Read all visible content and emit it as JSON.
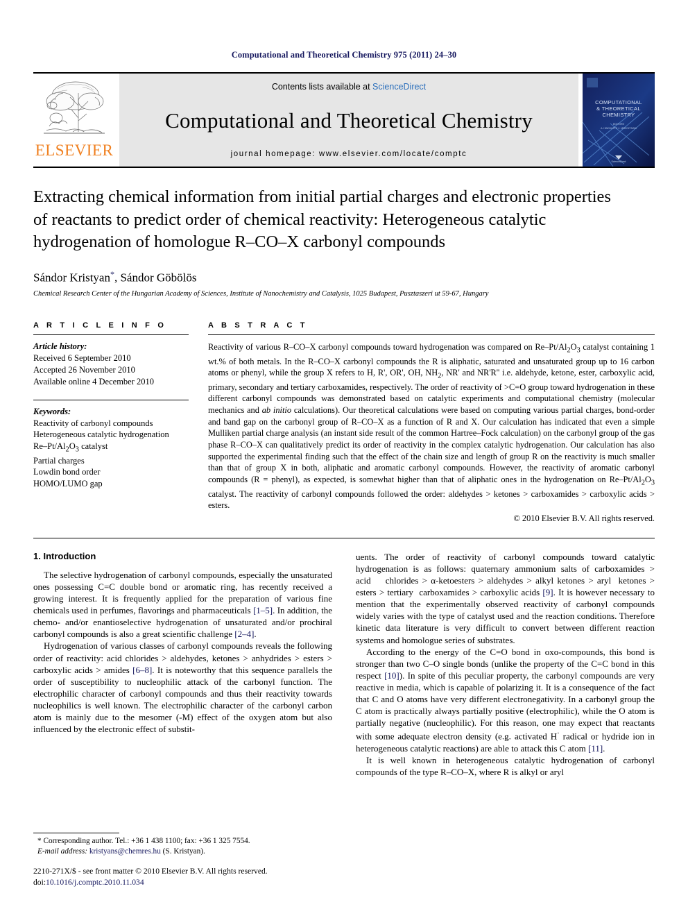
{
  "running_head": "Computational and Theoretical Chemistry 975 (2011) 24–30",
  "masthead": {
    "publisher_name": "ELSEVIER",
    "contents_prefix": "Contents lists available at ",
    "sciencedirect": "ScienceDirect",
    "journal_name": "Computational and Theoretical Chemistry",
    "homepage": "journal homepage: www.elsevier.com/locate/comptc",
    "cover_title_line1": "COMPUTATIONAL",
    "cover_title_line2": "& THEORETICAL",
    "cover_title_line3": "CHEMISTRY",
    "cover_sciencedirect": "ScienceDirect"
  },
  "article": {
    "title": "Extracting chemical information from initial partial charges and electronic properties of reactants to predict order of chemical reactivity: Heterogeneous catalytic hydrogenation of homologue R–CO–X carbonyl compounds",
    "authors": "Sándor Kristyan",
    "author_star": "*",
    "authors_rest": ", Sándor Göbölös",
    "affiliation": "Chemical Research Center of the Hungarian Academy of Sciences, Institute of Nanochemistry and Catalysis, 1025 Budapest, Pusztaszeri ut 59-67, Hungary"
  },
  "article_info": {
    "heading": "A R T I C L E   I N F O",
    "history_label": "Article history:",
    "history": [
      "Received 6 September 2010",
      "Accepted 26 November 2010",
      "Available online 4 December 2010"
    ],
    "keywords_label": "Keywords:",
    "keywords": [
      "Reactivity of carbonyl compounds",
      "Heterogeneous catalytic hydrogenation",
      "Re–Pt/Al2O3 catalyst",
      "Partial charges",
      "Lowdin bond order",
      "HOMO/LUMO gap"
    ]
  },
  "abstract": {
    "heading": "A B S T R A C T",
    "text": "Reactivity of various R–CO–X carbonyl compounds toward hydrogenation was compared on Re–Pt/Al2O3 catalyst containing 1 wt.% of both metals. In the R–CO–X carbonyl compounds the R is aliphatic, saturated and unsaturated group up to 16 carbon atoms or phenyl, while the group X refers to H, R', OR', OH, NH2, NR' and NR'R'' i.e. aldehyde, ketone, ester, carboxylic acid, primary, secondary and tertiary carboxamides, respectively. The order of reactivity of >C=O group toward hydrogenation in these different carbonyl compounds was demonstrated based on catalytic experiments and computational chemistry (molecular mechanics and ab initio calculations). Our theoretical calculations were based on computing various partial charges, bond-order and band gap on the carbonyl group of R–CO–X as a function of R and X. Our calculation has indicated that even a simple Mulliken partial charge analysis (an instant side result of the common Hartree–Fock calculation) on the carbonyl group of the gas phase R–CO–X can qualitatively predict its order of reactivity in the complex catalytic hydrogenation. Our calculation has also supported the experimental finding such that the effect of the chain size and length of group R on the reactivity is much smaller than that of group X in both, aliphatic and aromatic carbonyl compounds. However, the reactivity of aromatic carbonyl compounds (R = phenyl), as expected, is somewhat higher than that of aliphatic ones in the hydrogenation on Re–Pt/Al2O3 catalyst. The reactivity of carbonyl compounds followed the order: aldehydes > ketones > carboxamides > carboxylic acids > esters.",
    "copyright": "© 2010 Elsevier B.V. All rights reserved."
  },
  "body": {
    "section_title": "1. Introduction",
    "left_paragraphs": [
      "The selective hydrogenation of carbonyl compounds, especially the unsaturated ones possessing C=C double bond or aromatic ring, has recently received a growing interest. It is frequently applied for the preparation of various fine chemicals used in perfumes, flavorings and pharmaceuticals [1–5]. In addition, the chemo- and/or enantioselective hydrogenation of unsaturated and/or prochiral carbonyl compounds is also a great scientific challenge [2–4].",
      "Hydrogenation of various classes of carbonyl compounds reveals the following order of reactivity: acid chlorides > aldehydes, ketones > anhydrides > esters > carboxylic acids > amides [6–8]. It is noteworthy that this sequence parallels the order of susceptibility to nucleophilic attack of the carbonyl function. The electrophilic character of carbonyl compounds and thus their reactivity towards nucleophilics is well known. The electrophilic character of the carbonyl carbon atom is mainly due to the mesomer (-M) effect of the oxygen atom but also influenced by the electronic effect of substit-"
    ],
    "right_paragraphs": [
      "uents. The order of reactivity of carbonyl compounds toward catalytic hydrogenation is as follows: quaternary ammonium salts of carboxamides > acid chlorides > α-ketoesters > aldehydes > alkyl ketones > aryl ketones > esters > tertiary carboxamides > carboxylic acids [9]. It is however necessary to mention that the experimentally observed reactivity of carbonyl compounds widely varies with the type of catalyst used and the reaction conditions. Therefore kinetic data literature is very difficult to convert between different reaction systems and homologue series of substrates.",
      "According to the energy of the C=O bond in oxo-compounds, this bond is stronger than two C–O single bonds (unlike the property of the C=C bond in this respect [10]). In spite of this peculiar property, the carbonyl compounds are very reactive in media, which is capable of polarizing it. It is a consequence of the fact that C and O atoms have very different electronegativity. In a carbonyl group the C atom is practically always partially positive (electrophilic), while the O atom is partially negative (nucleophilic). For this reason, one may expect that reactants with some adequate electron density (e.g. activated H· radical or hydride ion in heterogeneous catalytic reactions) are able to attack this C atom [11].",
      "It is well known in heterogeneous catalytic hydrogenation of carbonyl compounds of the type R–CO–X, where R is alkyl or aryl"
    ]
  },
  "footnotes": {
    "corresponding": "* Corresponding author. Tel.: +36 1 438 1100; fax: +36 1 325 7554.",
    "email_label": "E-mail address:",
    "email": "kristyans@chemres.hu",
    "email_suffix": "(S. Kristyan).",
    "issn_line": "2210-271X/$ - see front matter © 2010 Elsevier B.V. All rights reserved.",
    "doi_label": "doi:",
    "doi": "10.1016/j.comptc.2010.11.034"
  },
  "colors": {
    "elsevier_orange": "#f08020",
    "link_blue": "#15175e",
    "sciencedirect_blue": "#2a6ebb",
    "masthead_gray": "#e6e6e6",
    "cover_navy": "#0d1b4c"
  }
}
